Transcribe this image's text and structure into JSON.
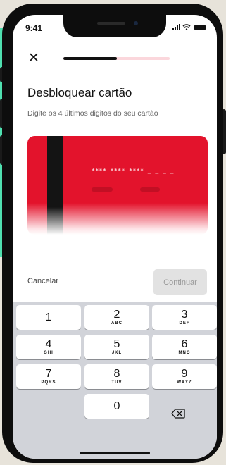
{
  "status_bar": {
    "time": "9:41"
  },
  "header": {
    "close_icon": "close-icon",
    "progress_fraction": 0.5
  },
  "title": "Desbloquear cartão",
  "subtitle": "Digite os 4 últimos digitos do seu cartão",
  "card": {
    "masked_number": "**** **** ****",
    "placeholder": "_ _ _ _",
    "color": "#e3132c"
  },
  "actions": {
    "cancel_label": "Cancelar",
    "continue_label": "Continuar"
  },
  "keypad": {
    "keys": [
      {
        "digit": "1",
        "letters": ""
      },
      {
        "digit": "2",
        "letters": "ABC"
      },
      {
        "digit": "3",
        "letters": "DEF"
      },
      {
        "digit": "4",
        "letters": "GHI"
      },
      {
        "digit": "5",
        "letters": "JKL"
      },
      {
        "digit": "6",
        "letters": "MNO"
      },
      {
        "digit": "7",
        "letters": "PQRS"
      },
      {
        "digit": "8",
        "letters": "TUV"
      },
      {
        "digit": "9",
        "letters": "WXYZ"
      },
      {
        "digit": "0",
        "letters": ""
      }
    ],
    "delete_icon": "backspace-icon"
  },
  "colors": {
    "brand_red": "#e3132c",
    "progress_track": "#fbd7dc",
    "mint_accent": "#4fe0b0"
  }
}
